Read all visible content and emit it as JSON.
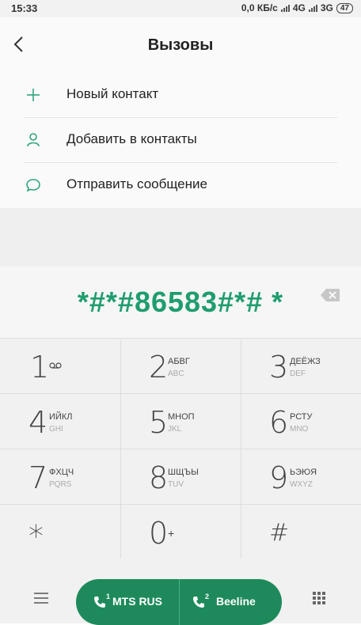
{
  "status": {
    "time": "15:33",
    "speed": "0,0 КБ/с",
    "net1": "4G",
    "net2": "3G",
    "battery": "47"
  },
  "header": {
    "title": "Вызовы"
  },
  "menu": [
    {
      "label": "Новый контакт",
      "icon": "plus-icon"
    },
    {
      "label": "Добавить в контакты",
      "icon": "person-icon"
    },
    {
      "label": "Отправить сообщение",
      "icon": "message-icon"
    }
  ],
  "dialed_number": "*#*#86583#*# *",
  "keys": [
    {
      "digit": "1",
      "letters": "",
      "latin": ""
    },
    {
      "digit": "2",
      "letters": "АБВГ",
      "latin": "ABC"
    },
    {
      "digit": "3",
      "letters": "ДЕЁЖЗ",
      "latin": "DEF"
    },
    {
      "digit": "4",
      "letters": "ИЙКЛ",
      "latin": "GHI"
    },
    {
      "digit": "5",
      "letters": "МНОП",
      "latin": "JKL"
    },
    {
      "digit": "6",
      "letters": "РСТУ",
      "latin": "MNO"
    },
    {
      "digit": "7",
      "letters": "ФХЦЧ",
      "latin": "PQRS"
    },
    {
      "digit": "8",
      "letters": "ШЩЪЫ",
      "latin": "TUV"
    },
    {
      "digit": "9",
      "letters": "ЬЭЮЯ",
      "latin": "WXYZ"
    },
    {
      "digit": "*",
      "letters": "",
      "latin": ""
    },
    {
      "digit": "0",
      "letters": "+",
      "latin": ""
    },
    {
      "digit": "#",
      "letters": "",
      "latin": ""
    }
  ],
  "sim1": {
    "label": "MTS RUS",
    "slot": "1"
  },
  "sim2": {
    "label": "Beeline",
    "slot": "2"
  },
  "colors": {
    "accent": "#1f9d6e",
    "call_button": "#1e8a5b"
  }
}
